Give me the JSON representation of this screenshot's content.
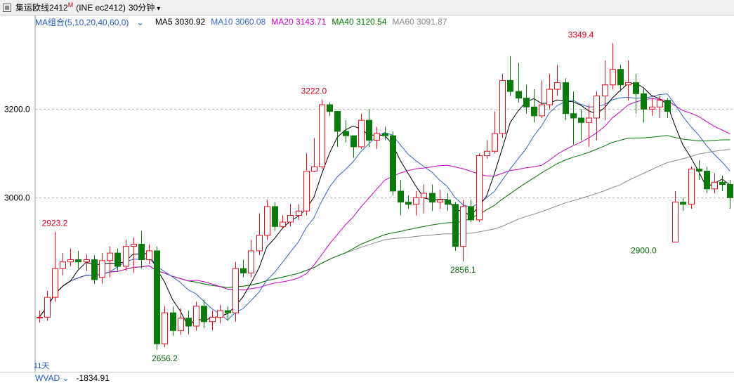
{
  "titlebar": {
    "name": "集运欧线2412",
    "mark": "M",
    "exchange": "(INE ec2412)",
    "period": "30分钟"
  },
  "legend": {
    "group": "MA组合(5,10,20,40,60,0)",
    "ma5": "MA5 3030.92",
    "ma10": "MA10 3060.08",
    "ma20": "MA20 3143.71",
    "ma40": "MA40 3120.54",
    "ma60": "MA60 3091.87"
  },
  "colors": {
    "up": "#e8101e",
    "down": "#0a7a0a",
    "ma5": "#000000",
    "ma10": "#3366cc",
    "ma20": "#cc00cc",
    "ma40": "#007700",
    "ma60": "#888888",
    "grid": "#bfbfbf"
  },
  "bottom": {
    "indicator": "WVAD",
    "value": "-1834.91",
    "period_label": "11天"
  },
  "chart_data": {
    "type": "candlestick",
    "y_ticks": [
      {
        "value": 3200,
        "label": "3200.0"
      },
      {
        "value": 3000,
        "label": "3000.0"
      }
    ],
    "ylim": [
      2610,
      3380
    ],
    "annotations": [
      {
        "index": 2,
        "value": 2923.2,
        "label": "2923.2",
        "kind": "high"
      },
      {
        "index": 16,
        "value": 2656.2,
        "label": "2656.2",
        "kind": "low"
      },
      {
        "index": 35,
        "value": 3222.0,
        "label": "3222.0",
        "kind": "high"
      },
      {
        "index": 54,
        "value": 2856.1,
        "label": "2856.1",
        "kind": "low"
      },
      {
        "index": 69,
        "value": 3349.4,
        "label": "3349.4",
        "kind": "high"
      },
      {
        "index": 77,
        "value": 2900.0,
        "label": "2900.0",
        "kind": "low"
      }
    ],
    "candles": [
      [
        2730,
        2730,
        2745,
        2718
      ],
      [
        2730,
        2775,
        2790,
        2722
      ],
      [
        2775,
        2840,
        2923,
        2765
      ],
      [
        2840,
        2855,
        2875,
        2825
      ],
      [
        2855,
        2860,
        2885,
        2845
      ],
      [
        2860,
        2855,
        2880,
        2840
      ],
      [
        2855,
        2860,
        2872,
        2835
      ],
      [
        2860,
        2815,
        2870,
        2805
      ],
      [
        2820,
        2858,
        2875,
        2805
      ],
      [
        2858,
        2875,
        2890,
        2820
      ],
      [
        2875,
        2845,
        2885,
        2835
      ],
      [
        2845,
        2890,
        2905,
        2835
      ],
      [
        2890,
        2895,
        2910,
        2830
      ],
      [
        2895,
        2860,
        2925,
        2840
      ],
      [
        2860,
        2880,
        2895,
        2850
      ],
      [
        2880,
        2670,
        2890,
        2656
      ],
      [
        2670,
        2740,
        2755,
        2662
      ],
      [
        2740,
        2700,
        2755,
        2688
      ],
      [
        2700,
        2728,
        2750,
        2690
      ],
      [
        2728,
        2710,
        2745,
        2692
      ],
      [
        2710,
        2755,
        2765,
        2700
      ],
      [
        2755,
        2720,
        2770,
        2705
      ],
      [
        2720,
        2730,
        2745,
        2700
      ],
      [
        2730,
        2745,
        2758,
        2716
      ],
      [
        2745,
        2740,
        2755,
        2722
      ],
      [
        2740,
        2840,
        2855,
        2720
      ],
      [
        2840,
        2830,
        2860,
        2820
      ],
      [
        2830,
        2880,
        2905,
        2820
      ],
      [
        2880,
        2915,
        2965,
        2870
      ],
      [
        2915,
        2980,
        2995,
        2905
      ],
      [
        2980,
        2935,
        2990,
        2925
      ],
      [
        2935,
        2945,
        2960,
        2930
      ],
      [
        2945,
        2960,
        2985,
        2935
      ],
      [
        2960,
        2970,
        2985,
        2950
      ],
      [
        2970,
        3060,
        3100,
        2960
      ],
      [
        3060,
        3070,
        3135,
        3058
      ],
      [
        3070,
        3210,
        3222,
        3065
      ],
      [
        3210,
        3195,
        3215,
        3185
      ],
      [
        3195,
        3150,
        3155,
        3115
      ],
      [
        3150,
        3140,
        3175,
        3125
      ],
      [
        3140,
        3115,
        3125,
        3090
      ],
      [
        3115,
        3175,
        3190,
        3110
      ],
      [
        3175,
        3130,
        3200,
        3115
      ],
      [
        3130,
        3145,
        3160,
        3110
      ],
      [
        3145,
        3140,
        3160,
        3130
      ],
      [
        3140,
        3015,
        3150,
        3005
      ],
      [
        3015,
        2990,
        3040,
        2960
      ],
      [
        2990,
        2985,
        3005,
        2975
      ],
      [
        2985,
        3000,
        3015,
        2960
      ],
      [
        3000,
        3010,
        3030,
        2965
      ],
      [
        3010,
        2990,
        3030,
        2970
      ],
      [
        2990,
        2995,
        3018,
        2975
      ],
      [
        2995,
        2985,
        3010,
        2970
      ],
      [
        2985,
        2890,
        2990,
        2880
      ],
      [
        2890,
        2980,
        2995,
        2856
      ],
      [
        2980,
        2950,
        2995,
        2945
      ],
      [
        2950,
        3095,
        3100,
        2945
      ],
      [
        3095,
        3105,
        3130,
        3088
      ],
      [
        3105,
        3145,
        3195,
        3100
      ],
      [
        3145,
        3265,
        3280,
        3135
      ],
      [
        3265,
        3240,
        3320,
        3230
      ],
      [
        3240,
        3225,
        3305,
        3215
      ],
      [
        3225,
        3205,
        3255,
        3190
      ],
      [
        3205,
        3185,
        3245,
        3170
      ],
      [
        3185,
        3210,
        3265,
        3180
      ],
      [
        3210,
        3245,
        3280,
        3200
      ],
      [
        3245,
        3260,
        3300,
        3230
      ],
      [
        3260,
        3190,
        3270,
        3175
      ],
      [
        3190,
        3180,
        3240,
        3120
      ],
      [
        3180,
        3170,
        3200,
        3130
      ],
      [
        3170,
        3180,
        3210,
        3115
      ],
      [
        3180,
        3230,
        3240,
        3130
      ],
      [
        3230,
        3255,
        3310,
        3175
      ],
      [
        3255,
        3290,
        3349,
        3245
      ],
      [
        3290,
        3255,
        3300,
        3240
      ],
      [
        3255,
        3260,
        3310,
        3220
      ],
      [
        3260,
        3235,
        3280,
        3190
      ],
      [
        3235,
        3200,
        3250,
        3170
      ],
      [
        3200,
        3205,
        3225,
        3185
      ],
      [
        3205,
        3220,
        3230,
        3180
      ],
      [
        3220,
        3195,
        3225,
        3180
      ],
      [
        2900,
        2990,
        3015,
        2900
      ],
      [
        2990,
        2985,
        3000,
        2970
      ],
      [
        2985,
        3065,
        3070,
        2975
      ],
      [
        3065,
        3060,
        3085,
        3040
      ],
      [
        3060,
        3020,
        3070,
        3010
      ],
      [
        3020,
        3035,
        3055,
        3010
      ],
      [
        3035,
        3030,
        3050,
        3015
      ],
      [
        3030,
        3000,
        3040,
        2975
      ]
    ]
  }
}
